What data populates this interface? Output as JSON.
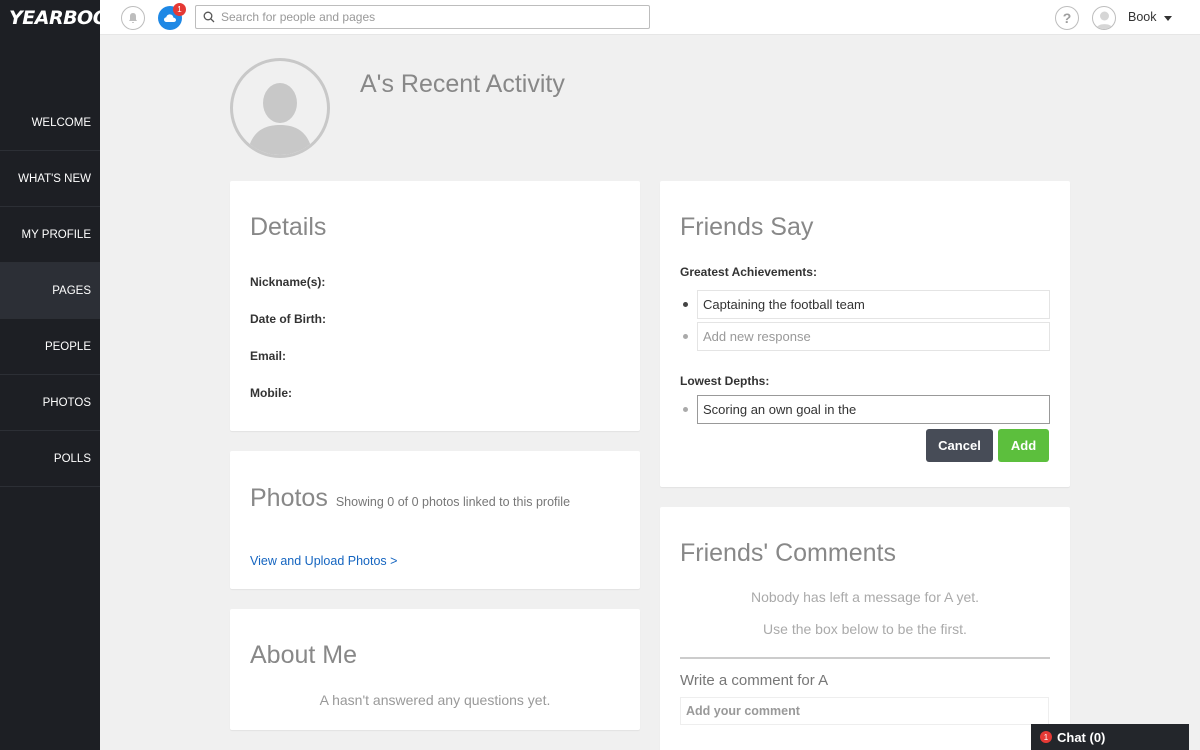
{
  "app": {
    "logo": "YEARBOOK"
  },
  "sidebar": {
    "items": [
      {
        "label": "WELCOME"
      },
      {
        "label": "WHAT'S NEW"
      },
      {
        "label": "MY PROFILE"
      },
      {
        "label": "PAGES",
        "active": true
      },
      {
        "label": "PEOPLE"
      },
      {
        "label": "PHOTOS"
      },
      {
        "label": "POLLS"
      }
    ]
  },
  "topbar": {
    "bell_icon": "bell-icon",
    "notifications": {
      "icon": "notification-cloud-icon",
      "count": "1"
    },
    "search": {
      "placeholder": "Search for people and pages",
      "value": ""
    },
    "help_icon": "?",
    "user": {
      "name": "Book"
    }
  },
  "header": {
    "title": "A's Recent Activity"
  },
  "details": {
    "title": "Details",
    "fields": [
      "Nickname(s):",
      "Date of Birth:",
      "Email:",
      "Mobile:"
    ]
  },
  "photos": {
    "title": "Photos",
    "subtitle": "Showing 0 of 0 photos linked to this profile",
    "link": "View and Upload Photos >"
  },
  "about": {
    "title": "About Me",
    "empty": "A hasn't answered any questions yet."
  },
  "friends_say": {
    "title": "Friends Say",
    "achievements_label": "Greatest Achievements:",
    "achievements": [
      "Captaining the football team"
    ],
    "new_response_placeholder": "Add new response",
    "depths_label": "Lowest Depths:",
    "depths_value": "Scoring an own goal in the",
    "cancel_label": "Cancel",
    "add_label": "Add"
  },
  "comments": {
    "title": "Friends' Comments",
    "empty_1": "Nobody has left a message for A yet.",
    "empty_2": "Use the box below to be the first.",
    "write_label": "Write a comment for A",
    "input_placeholder": "Add your comment"
  },
  "chat": {
    "badge": "1",
    "label": "Chat (0)"
  },
  "colors": {
    "sidebar_bg": "#1d1f24",
    "accent_blue": "#1e88e5",
    "badge_red": "#e53935",
    "add_green": "#5cbf3d",
    "cancel_dark": "#474c57",
    "link_blue": "#1565c0"
  }
}
